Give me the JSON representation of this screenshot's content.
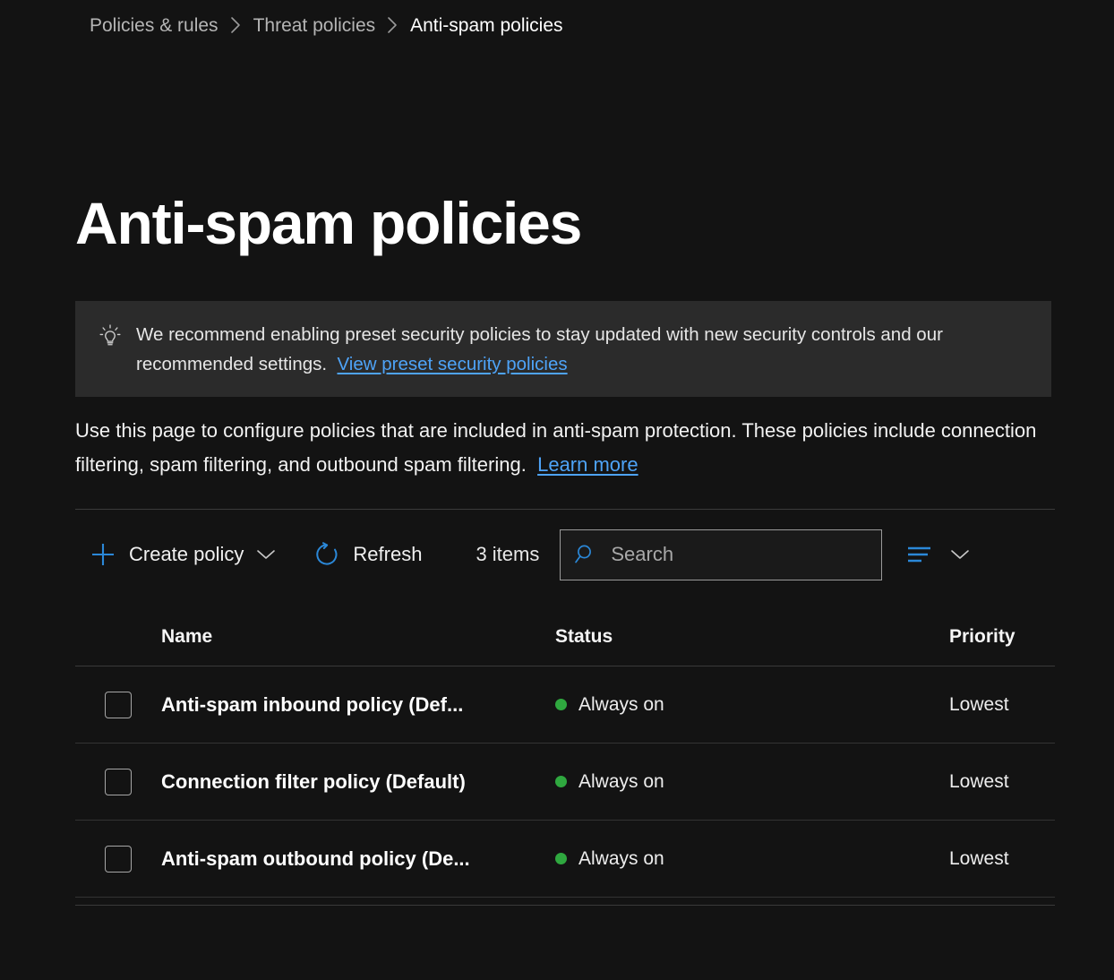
{
  "breadcrumb": {
    "items": [
      {
        "label": "Policies & rules",
        "current": false
      },
      {
        "label": "Threat policies",
        "current": false
      },
      {
        "label": "Anti-spam policies",
        "current": true
      }
    ],
    "separator_icon": "chevron-right-icon"
  },
  "header": {
    "title": "Anti-spam policies"
  },
  "banner": {
    "icon": "lightbulb-icon",
    "text": "We recommend enabling preset security policies to stay updated with new security controls and our recommended settings.",
    "link_label": "View preset security policies",
    "background": "#2b2b2b"
  },
  "description": {
    "text": "Use this page to configure policies that are included in anti-spam protection. These policies include connection filtering, spam filtering, and outbound spam filtering.",
    "link_label": "Learn more"
  },
  "toolbar": {
    "create_policy_label": "Create policy",
    "create_policy_icon": "plus-icon",
    "create_policy_chevron_icon": "chevron-down-icon",
    "refresh_label": "Refresh",
    "refresh_icon": "refresh-icon",
    "item_count_label": "3 items",
    "search_placeholder": "Search",
    "search_value": "",
    "search_icon": "search-icon",
    "filter_icon": "sort-filter-icon",
    "filter_chevron_icon": "chevron-down-icon",
    "accent_color": "#2b88d8"
  },
  "table": {
    "columns": [
      "Name",
      "Status",
      "Priority"
    ],
    "rows": [
      {
        "checked": false,
        "name": "Anti-spam inbound policy (Def...",
        "status": "Always on",
        "status_color": "#2fa83f",
        "priority": "Lowest"
      },
      {
        "checked": false,
        "name": "Connection filter policy (Default)",
        "status": "Always on",
        "status_color": "#2fa83f",
        "priority": "Lowest"
      },
      {
        "checked": false,
        "name": "Anti-spam outbound policy (De...",
        "status": "Always on",
        "status_color": "#2fa83f",
        "priority": "Lowest"
      }
    ]
  }
}
